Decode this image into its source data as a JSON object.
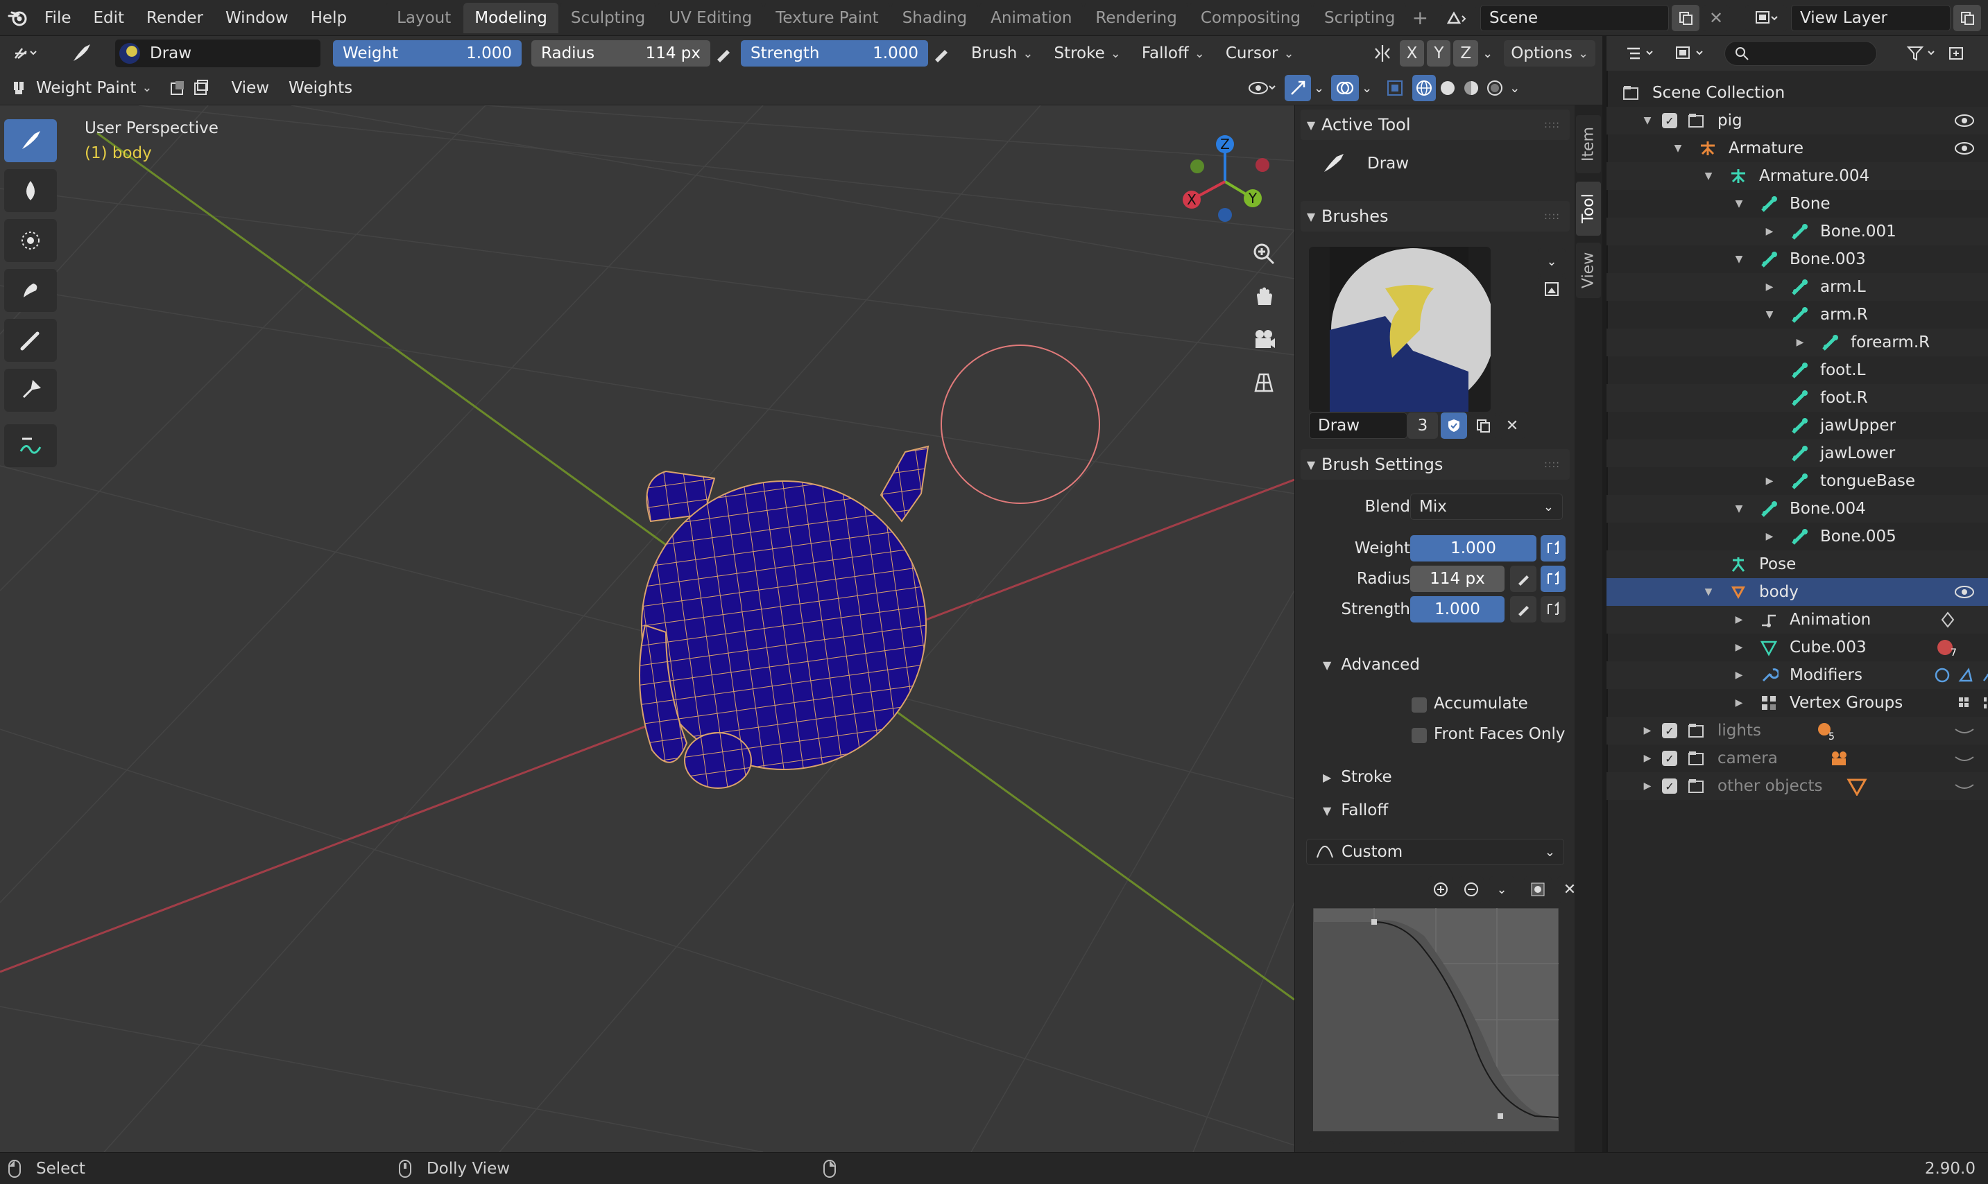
{
  "app": {
    "version": "2.90.0"
  },
  "menu": [
    "File",
    "Edit",
    "Render",
    "Window",
    "Help"
  ],
  "workspaces": [
    {
      "label": "Layout",
      "active": false
    },
    {
      "label": "Modeling",
      "active": true
    },
    {
      "label": "Sculpting",
      "active": false
    },
    {
      "label": "UV Editing",
      "active": false
    },
    {
      "label": "Texture Paint",
      "active": false
    },
    {
      "label": "Shading",
      "active": false
    },
    {
      "label": "Animation",
      "active": false
    },
    {
      "label": "Rendering",
      "active": false
    },
    {
      "label": "Compositing",
      "active": false
    },
    {
      "label": "Scripting",
      "active": false
    }
  ],
  "scene": {
    "name": "Scene",
    "view_layer": "View Layer"
  },
  "tool_settings": {
    "brush_name": "Draw",
    "weight_label": "Weight",
    "weight_value": "1.000",
    "radius_label": "Radius",
    "radius_value": "114 px",
    "strength_label": "Strength",
    "strength_value": "1.000",
    "brush_menu": "Brush",
    "stroke_menu": "Stroke",
    "falloff_menu": "Falloff",
    "cursor_menu": "Cursor",
    "axis_x": "X",
    "axis_y": "Y",
    "axis_z": "Z",
    "options": "Options"
  },
  "view_header": {
    "mode": "Weight Paint",
    "view_menu": "View",
    "weights_menu": "Weights"
  },
  "viewport": {
    "perspective_label": "User Perspective",
    "object_label": "(1) body",
    "gizmo": {
      "x": "X",
      "y": "Y",
      "z": "Z"
    }
  },
  "npanel": {
    "tabs": [
      "Item",
      "Tool",
      "View"
    ],
    "active_tool_title": "Active Tool",
    "active_tool_name": "Draw",
    "brushes_title": "Brushes",
    "brush_name": "Draw",
    "brush_users": "3",
    "brush_settings_title": "Brush Settings",
    "blend_label": "Blend",
    "blend_value": "Mix",
    "weight_label": "Weight",
    "weight_value": "1.000",
    "radius_label": "Radius",
    "radius_value": "114 px",
    "strength_label": "Strength",
    "strength_value": "1.000",
    "advanced_title": "Advanced",
    "accumulate_label": "Accumulate",
    "accumulate": false,
    "front_faces_label": "Front Faces Only",
    "front_faces": false,
    "stroke_title": "Stroke",
    "falloff_title": "Falloff",
    "falloff_preset": "Custom"
  },
  "outliner": {
    "rows": [
      {
        "label": "Scene Collection",
        "depth": 0,
        "icon": "collection-icon",
        "expand": "",
        "checkbox": false,
        "eye": false,
        "dim": false,
        "selected": false,
        "extra": ""
      },
      {
        "label": "pig",
        "depth": 1,
        "icon": "collection-icon",
        "expand": "down",
        "checkbox": true,
        "eye": true,
        "dim": false,
        "selected": false,
        "extra": ""
      },
      {
        "label": "Armature",
        "depth": 2,
        "icon": "armature-icon",
        "expand": "down",
        "checkbox": false,
        "eye": true,
        "dim": false,
        "selected": false,
        "extra": ""
      },
      {
        "label": "Armature.004",
        "depth": 3,
        "icon": "armature-data-icon",
        "expand": "down",
        "checkbox": false,
        "eye": false,
        "dim": false,
        "selected": false,
        "extra": ""
      },
      {
        "label": "Bone",
        "depth": 4,
        "icon": "bone-icon",
        "expand": "down",
        "checkbox": false,
        "eye": false,
        "dim": false,
        "selected": false,
        "extra": ""
      },
      {
        "label": "Bone.001",
        "depth": 5,
        "icon": "bone-icon",
        "expand": "right",
        "checkbox": false,
        "eye": false,
        "dim": false,
        "selected": false,
        "extra": "bone"
      },
      {
        "label": "Bone.003",
        "depth": 4,
        "icon": "bone-icon",
        "expand": "down",
        "checkbox": false,
        "eye": false,
        "dim": false,
        "selected": false,
        "extra": ""
      },
      {
        "label": "arm.L",
        "depth": 5,
        "icon": "bone-icon",
        "expand": "right",
        "checkbox": false,
        "eye": false,
        "dim": false,
        "selected": false,
        "extra": "bone"
      },
      {
        "label": "arm.R",
        "depth": 5,
        "icon": "bone-icon",
        "expand": "down",
        "checkbox": false,
        "eye": false,
        "dim": false,
        "selected": false,
        "extra": ""
      },
      {
        "label": "forearm.R",
        "depth": 6,
        "icon": "bone-icon",
        "expand": "right",
        "checkbox": false,
        "eye": false,
        "dim": false,
        "selected": false,
        "extra": "bone"
      },
      {
        "label": "foot.L",
        "depth": 5,
        "icon": "bone-icon",
        "expand": "",
        "checkbox": false,
        "eye": false,
        "dim": false,
        "selected": false,
        "extra": ""
      },
      {
        "label": "foot.R",
        "depth": 5,
        "icon": "bone-icon",
        "expand": "",
        "checkbox": false,
        "eye": false,
        "dim": false,
        "selected": false,
        "extra": ""
      },
      {
        "label": "jawUpper",
        "depth": 5,
        "icon": "bone-icon",
        "expand": "",
        "checkbox": false,
        "eye": false,
        "dim": false,
        "selected": false,
        "extra": ""
      },
      {
        "label": "jawLower",
        "depth": 5,
        "icon": "bone-icon",
        "expand": "",
        "checkbox": false,
        "eye": false,
        "dim": false,
        "selected": false,
        "extra": ""
      },
      {
        "label": "tongueBase",
        "depth": 5,
        "icon": "bone-icon",
        "expand": "right",
        "checkbox": false,
        "eye": false,
        "dim": false,
        "selected": false,
        "extra": "bone"
      },
      {
        "label": "Bone.004",
        "depth": 4,
        "icon": "bone-icon",
        "expand": "down",
        "checkbox": false,
        "eye": false,
        "dim": false,
        "selected": false,
        "extra": ""
      },
      {
        "label": "Bone.005",
        "depth": 5,
        "icon": "bone-icon",
        "expand": "right",
        "checkbox": false,
        "eye": false,
        "dim": false,
        "selected": false,
        "extra": "bone"
      },
      {
        "label": "Pose",
        "depth": 3,
        "icon": "pose-icon",
        "expand": "",
        "checkbox": false,
        "eye": false,
        "dim": false,
        "selected": false,
        "extra": ""
      },
      {
        "label": "body",
        "depth": 3,
        "icon": "mesh-object-icon",
        "expand": "down",
        "checkbox": false,
        "eye": true,
        "dim": false,
        "selected": true,
        "extra": ""
      },
      {
        "label": "Animation",
        "depth": 4,
        "icon": "animation-icon",
        "expand": "right",
        "checkbox": false,
        "eye": false,
        "dim": false,
        "selected": false,
        "extra": "keyframe"
      },
      {
        "label": "Cube.003",
        "depth": 4,
        "icon": "mesh-data-icon",
        "expand": "right",
        "checkbox": false,
        "eye": false,
        "dim": false,
        "selected": false,
        "extra": "material"
      },
      {
        "label": "Modifiers",
        "depth": 4,
        "icon": "wrench-icon",
        "expand": "right",
        "checkbox": false,
        "eye": false,
        "dim": false,
        "selected": false,
        "extra": "modifiers"
      },
      {
        "label": "Vertex Groups",
        "depth": 4,
        "icon": "vertex-groups-icon",
        "expand": "right",
        "checkbox": false,
        "eye": false,
        "dim": false,
        "selected": false,
        "extra": "vgroups"
      },
      {
        "label": "lights",
        "depth": 1,
        "icon": "collection-icon",
        "expand": "right",
        "checkbox": true,
        "eye": false,
        "dim": true,
        "selected": false,
        "extra": "lights"
      },
      {
        "label": "camera",
        "depth": 1,
        "icon": "collection-icon",
        "expand": "right",
        "checkbox": true,
        "eye": false,
        "dim": true,
        "selected": false,
        "extra": "camera"
      },
      {
        "label": "other objects",
        "depth": 1,
        "icon": "collection-icon",
        "expand": "right",
        "checkbox": true,
        "eye": false,
        "dim": true,
        "selected": false,
        "extra": "mesh"
      }
    ],
    "light_count": "5",
    "material_count": "7"
  },
  "status": {
    "left_action": "Select",
    "middle_action": "Dolly View"
  },
  "colors": {
    "accent": "#4772b3",
    "bone": "#3dd6b4",
    "object_orange": "#e8873a",
    "selected_row": "#334d80",
    "mesh_blue": "#1a0c8c",
    "wire_orange": "#d9a26b"
  }
}
